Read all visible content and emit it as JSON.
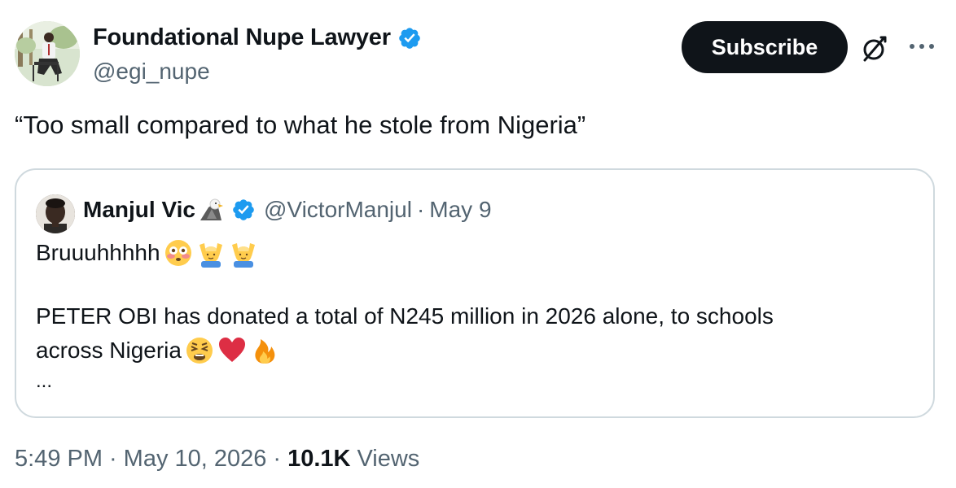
{
  "author": {
    "display_name": "Foundational Nupe Lawyer",
    "handle": "@egi_nupe",
    "verified": true
  },
  "actions": {
    "subscribe_label": "Subscribe",
    "grok_icon": "grok-icon",
    "more_icon": "more-icon"
  },
  "tweet": {
    "text": "“Too small compared to what he stole from Nigeria”"
  },
  "quoted": {
    "display_name": "Manjul Vic",
    "name_emoji": "eagle-emoji",
    "verified": true,
    "handle": "@VictorManjul",
    "separator": "·",
    "date": "May 9",
    "line1_text": "Bruuuhhhhh",
    "line1_emojis": [
      "flushed-face-emoji",
      "man-gesturing-ok-emoji",
      "man-gesturing-ok-emoji"
    ],
    "line2_text": "PETER OBI has donated a total of N245 million in 2026 alone, to schools",
    "line3_text": "across Nigeria ",
    "line3_emojis": [
      "weary-face-emoji",
      "red-heart-emoji",
      "fire-emoji"
    ],
    "ellipsis": "..."
  },
  "footer": {
    "time": "5:49 PM",
    "separator": "·",
    "date": "May 10, 2026",
    "views_count": "10.1K",
    "views_label": "Views"
  },
  "colors": {
    "text_primary": "#0f1419",
    "text_secondary": "#536471",
    "verified_blue": "#1d9bf0",
    "border": "#cfd9de",
    "button_bg": "#0f1419"
  }
}
